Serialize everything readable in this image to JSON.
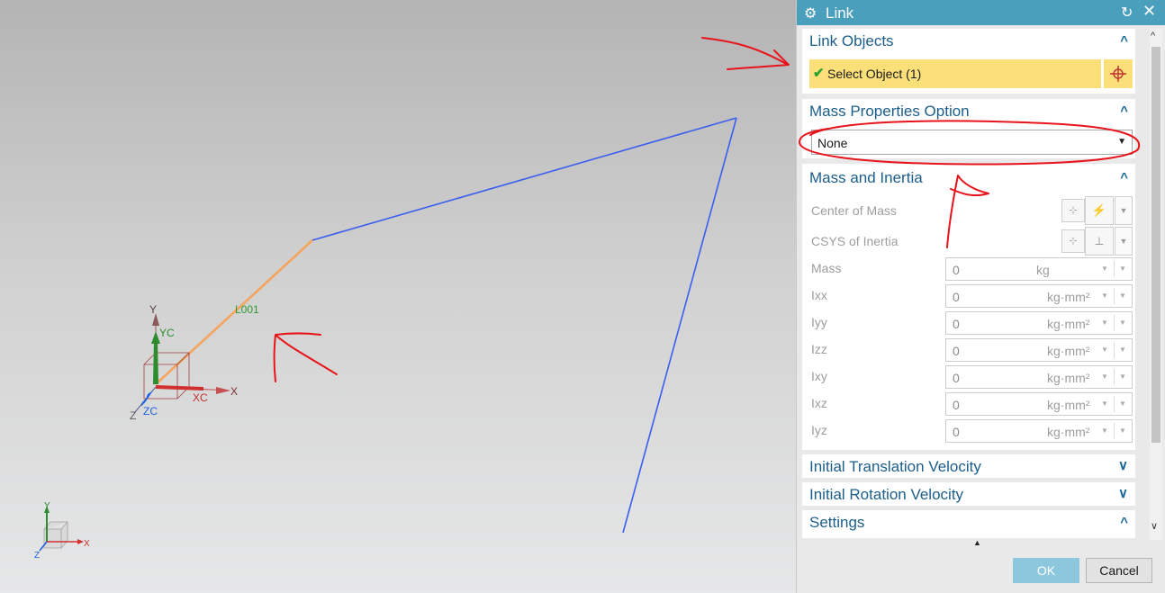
{
  "panel": {
    "title": "Link",
    "title_icon": "gear-icon",
    "link_objects": {
      "header": "Link Objects",
      "select_label": "Select Object (1)"
    },
    "mass_properties": {
      "header": "Mass Properties Option",
      "value": "None"
    },
    "mass_inertia": {
      "header": "Mass and Inertia",
      "center_of_mass": "Center of Mass",
      "csys": "CSYS of Inertia",
      "rows": [
        {
          "label": "Mass",
          "value": "0",
          "unit": "kg"
        },
        {
          "label": "Ixx",
          "value": "0",
          "unit": "kg·mm²"
        },
        {
          "label": "Iyy",
          "value": "0",
          "unit": "kg·mm²"
        },
        {
          "label": "Izz",
          "value": "0",
          "unit": "kg·mm²"
        },
        {
          "label": "Ixy",
          "value": "0",
          "unit": "kg·mm²"
        },
        {
          "label": "Ixz",
          "value": "0",
          "unit": "kg·mm²"
        },
        {
          "label": "Iyz",
          "value": "0",
          "unit": "kg·mm²"
        }
      ]
    },
    "initial_translation": "Initial Translation Velocity",
    "initial_rotation": "Initial Rotation Velocity",
    "settings": "Settings",
    "ok": "OK",
    "cancel": "Cancel"
  },
  "viewport": {
    "link_label": "L001",
    "axes": {
      "y": "Y",
      "yc": "YC",
      "x": "X",
      "xc": "XC",
      "z": "Z",
      "zc": "ZC"
    },
    "mini_axes": {
      "y": "Y",
      "x": "X",
      "z": "Z"
    }
  },
  "colors": {
    "titlebar": "#4a9fbd",
    "selection": "#fbe07a",
    "header_text": "#1b5e8a",
    "annotation": "#e8141c",
    "link_orange": "#f5a45d",
    "line_blue": "#3b5ef0",
    "ok_button": "#8cc7de"
  }
}
